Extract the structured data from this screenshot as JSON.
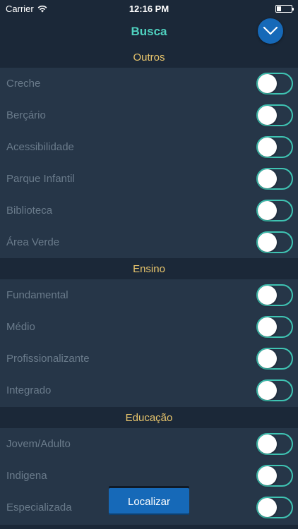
{
  "status_bar": {
    "carrier": "Carrier",
    "time": "12:16 PM",
    "battery_level": 0.3
  },
  "nav": {
    "title": "Busca",
    "collapse_icon": "chevron-down-icon"
  },
  "colors": {
    "accent": "#4fd1bf",
    "section_title": "#e8c56c",
    "button": "#1669b8",
    "toggle_border": "#3fc4b3"
  },
  "sections": [
    {
      "title": "Outros",
      "items": [
        {
          "label": "Creche",
          "on": false
        },
        {
          "label": "Berçário",
          "on": false
        },
        {
          "label": "Acessibilidade",
          "on": false
        },
        {
          "label": "Parque Infantil",
          "on": false
        },
        {
          "label": "Biblioteca",
          "on": false
        },
        {
          "label": "Área Verde",
          "on": false
        }
      ]
    },
    {
      "title": "Ensino",
      "items": [
        {
          "label": "Fundamental",
          "on": false
        },
        {
          "label": "Médio",
          "on": false
        },
        {
          "label": "Profissionalizante",
          "on": false
        },
        {
          "label": "Integrado",
          "on": false
        }
      ]
    },
    {
      "title": "Educação",
      "items": [
        {
          "label": "Jovem/Adulto",
          "on": false
        },
        {
          "label": "Indigena",
          "on": false
        },
        {
          "label": "Especializada",
          "on": false
        }
      ]
    }
  ],
  "locate_button": {
    "label": "Localizar"
  }
}
